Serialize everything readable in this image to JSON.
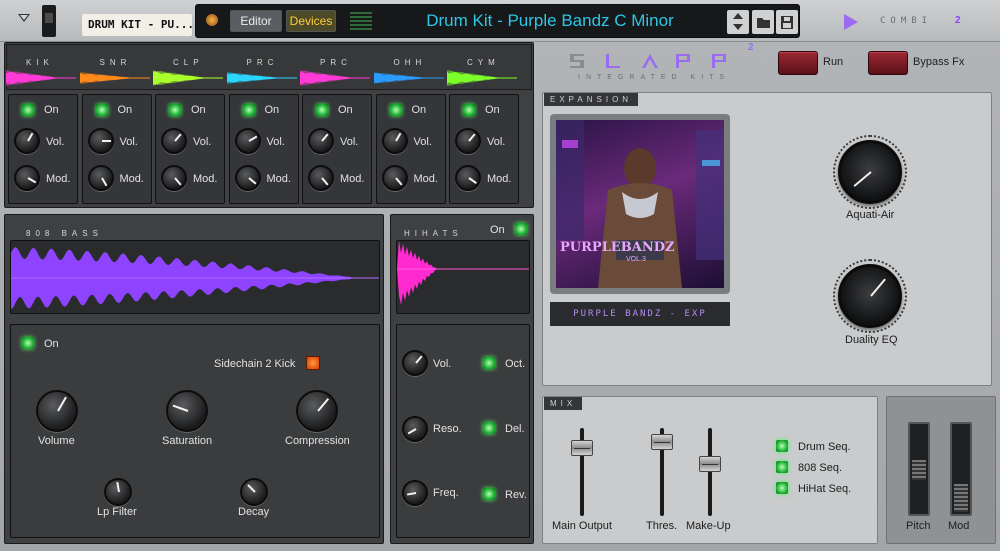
{
  "topbar": {
    "patch_name": "DRUM KIT - PU...",
    "editor_label": "Editor",
    "devices_label": "Devices",
    "title": "Drum Kit - Purple Bandz C Minor",
    "brand_text": "COMBI",
    "brand_number": "2"
  },
  "drums": {
    "channels": [
      {
        "label": "KIK",
        "on": "On",
        "vol": "Vol.",
        "mod": "Mod.",
        "color": "#ff3ad6"
      },
      {
        "label": "SNR",
        "on": "On",
        "vol": "Vol.",
        "mod": "Mod.",
        "color": "#ff8a1a"
      },
      {
        "label": "CLP",
        "on": "On",
        "vol": "Vol.",
        "mod": "Mod.",
        "color": "#a8ff2a"
      },
      {
        "label": "PRC",
        "on": "On",
        "vol": "Vol.",
        "mod": "Mod.",
        "color": "#2ad6ff"
      },
      {
        "label": "PRC",
        "on": "On",
        "vol": "Vol.",
        "mod": "Mod.",
        "color": "#ff3ad6"
      },
      {
        "label": "OHH",
        "on": "On",
        "vol": "Vol.",
        "mod": "Mod.",
        "color": "#2a9cff"
      },
      {
        "label": "CYM",
        "on": "On",
        "vol": "Vol.",
        "mod": "Mod.",
        "color": "#7dff2a"
      }
    ]
  },
  "bass": {
    "label": "808 BASS",
    "on": "On",
    "sidechain": "Sidechain 2 Kick",
    "knobs": {
      "volume": "Volume",
      "saturation": "Saturation",
      "compression": "Compression",
      "lp_filter": "Lp Filter",
      "decay": "Decay"
    },
    "wave_color": "#8e44ff"
  },
  "hihats": {
    "label": "HIHATS",
    "on": "On",
    "vol": "Vol.",
    "reso": "Reso.",
    "freq": "Freq.",
    "oct": "Oct.",
    "del": "Del.",
    "rev": "Rev.",
    "wave_color": "#ff2ad0"
  },
  "brand": {
    "logo_letters": "SLAPP",
    "logo_sup": "2",
    "subtitle": "INTEGRATED KITS",
    "run": "Run",
    "bypass": "Bypass Fx"
  },
  "expansion": {
    "label": "EXPANSION",
    "cover_title": "PURPLEBANDZ",
    "cover_volume": "VOL.3",
    "name": "PURPLE BANDZ - EXP",
    "knob1": "Aquati-Air",
    "knob2": "Duality EQ"
  },
  "mix": {
    "label": "MIX",
    "main_output": "Main Output",
    "thres": "Thres.",
    "makeup": "Make-Up",
    "seq": [
      "Drum Seq.",
      "808 Seq.",
      "HiHat Seq."
    ]
  },
  "wheels": {
    "pitch": "Pitch",
    "mod": "Mod"
  }
}
